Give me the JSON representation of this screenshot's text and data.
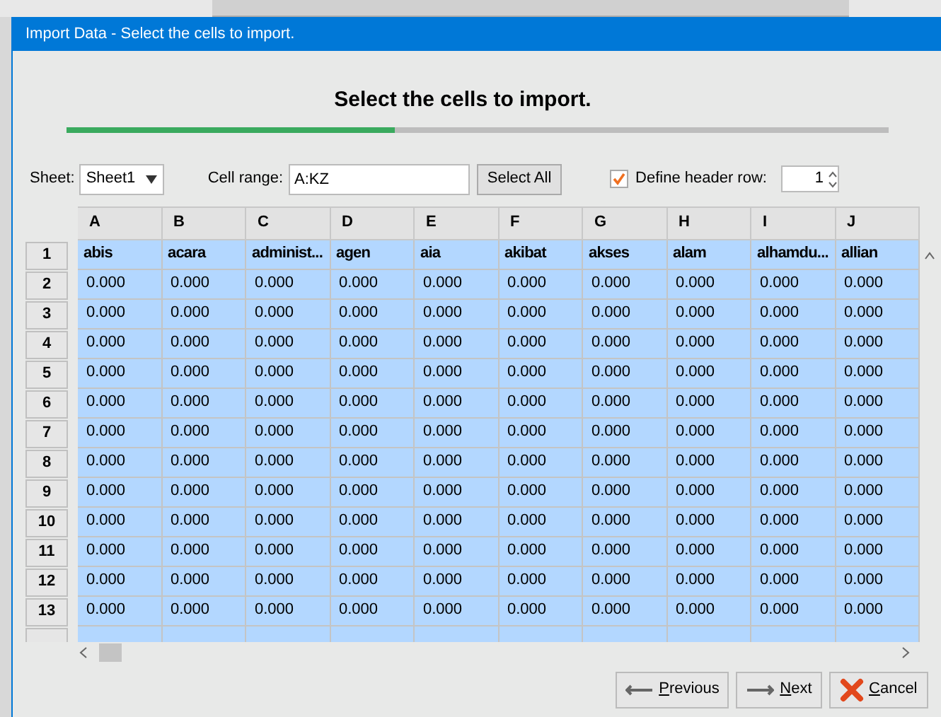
{
  "window": {
    "title": "Import Data - Select the cells to import."
  },
  "heading": "Select the cells to import.",
  "progress": {
    "level": 0.4
  },
  "sheet": {
    "label": "Sheet:",
    "value": "Sheet1"
  },
  "cell_range": {
    "label": "Cell range:",
    "value": "A:KZ"
  },
  "select_all": "Select All",
  "header_row": {
    "label": "Define header row:",
    "checked": true,
    "value": "1"
  },
  "table": {
    "columns": [
      "A",
      "B",
      "C",
      "D",
      "E",
      "F",
      "G",
      "H",
      "I",
      "J"
    ],
    "rows": [
      {
        "number": "1",
        "selected": true,
        "kind": "header",
        "cells": [
          "abis",
          "acara",
          "administ...",
          "agen",
          "aia",
          "akibat",
          "akses",
          "alam",
          "alhamdu...",
          "allian"
        ]
      },
      {
        "number": "2",
        "selected": true,
        "kind": "data",
        "cells": [
          "0.000",
          "0.000",
          "0.000",
          "0.000",
          "0.000",
          "0.000",
          "0.000",
          "0.000",
          "0.000",
          "0.000"
        ]
      },
      {
        "number": "3",
        "selected": true,
        "kind": "data",
        "cells": [
          "0.000",
          "0.000",
          "0.000",
          "0.000",
          "0.000",
          "0.000",
          "0.000",
          "0.000",
          "0.000",
          "0.000"
        ]
      },
      {
        "number": "4",
        "selected": true,
        "kind": "data",
        "cells": [
          "0.000",
          "0.000",
          "0.000",
          "0.000",
          "0.000",
          "0.000",
          "0.000",
          "0.000",
          "0.000",
          "0.000"
        ]
      },
      {
        "number": "5",
        "selected": true,
        "kind": "data",
        "cells": [
          "0.000",
          "0.000",
          "0.000",
          "0.000",
          "0.000",
          "0.000",
          "0.000",
          "0.000",
          "0.000",
          "0.000"
        ]
      },
      {
        "number": "6",
        "selected": true,
        "kind": "data",
        "cells": [
          "0.000",
          "0.000",
          "0.000",
          "0.000",
          "0.000",
          "0.000",
          "0.000",
          "0.000",
          "0.000",
          "0.000"
        ]
      },
      {
        "number": "7",
        "selected": true,
        "kind": "data",
        "cells": [
          "0.000",
          "0.000",
          "0.000",
          "0.000",
          "0.000",
          "0.000",
          "0.000",
          "0.000",
          "0.000",
          "0.000"
        ]
      },
      {
        "number": "8",
        "selected": true,
        "kind": "data",
        "cells": [
          "0.000",
          "0.000",
          "0.000",
          "0.000",
          "0.000",
          "0.000",
          "0.000",
          "0.000",
          "0.000",
          "0.000"
        ]
      },
      {
        "number": "9",
        "selected": true,
        "kind": "data",
        "cells": [
          "0.000",
          "0.000",
          "0.000",
          "0.000",
          "0.000",
          "0.000",
          "0.000",
          "0.000",
          "0.000",
          "0.000"
        ]
      },
      {
        "number": "10",
        "selected": true,
        "kind": "data",
        "cells": [
          "0.000",
          "0.000",
          "0.000",
          "0.000",
          "0.000",
          "0.000",
          "0.000",
          "0.000",
          "0.000",
          "0.000"
        ]
      },
      {
        "number": "11",
        "selected": true,
        "kind": "data",
        "cells": [
          "0.000",
          "0.000",
          "0.000",
          "0.000",
          "0.000",
          "0.000",
          "0.000",
          "0.000",
          "0.000",
          "0.000"
        ]
      },
      {
        "number": "12",
        "selected": true,
        "kind": "data",
        "cells": [
          "0.000",
          "0.000",
          "0.000",
          "0.000",
          "0.000",
          "0.000",
          "0.000",
          "0.000",
          "0.000",
          "0.000"
        ]
      },
      {
        "number": "13",
        "selected": true,
        "kind": "data",
        "cells": [
          "0.000",
          "0.000",
          "0.000",
          "0.000",
          "0.000",
          "0.000",
          "0.000",
          "0.000",
          "0.000",
          "0.000"
        ]
      }
    ]
  },
  "buttons": {
    "previous": "Previous",
    "next": "Next",
    "cancel": "Cancel"
  }
}
